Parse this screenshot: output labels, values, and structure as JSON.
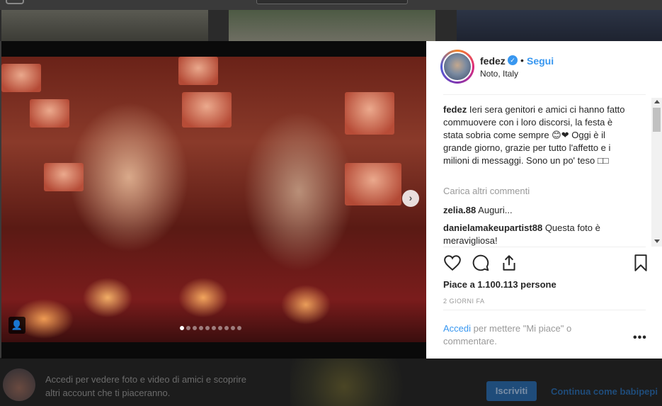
{
  "post": {
    "username": "fedez",
    "follow_label": "Segui",
    "separator": "•",
    "location": "Noto, Italy",
    "caption_user": "fedez",
    "caption_text": "Ieri sera genitori e amici ci hanno fatto commuovere con i loro discorsi, la festa è stata sobria come sempre 😊❤ Oggi è il grande giorno, grazie per tutto l'affetto e i milioni di messaggi. Sono un po' teso □□",
    "load_more": "Carica altri commenti",
    "comments": [
      {
        "user": "zelia.88",
        "text": "Auguri..."
      },
      {
        "user": "danielamakeupartist88",
        "text": "Questa foto è meravigliosa!"
      }
    ],
    "likes": "Piace a 1.100.113 persone",
    "timestamp": "2 GIORNI FA",
    "login_link": "Accedi",
    "login_rest": " per mettere \"Mi piace\" o commentare.",
    "more_options": "•••"
  },
  "carousel": {
    "dots_total": 10,
    "active_index": 0
  },
  "signup_bar": {
    "text": "Accedi per vedere foto e video di amici e scoprire altri account che ti piaceranno.",
    "register_label": "Iscriviti",
    "continue_label": "Continua come babipepi"
  },
  "colors": {
    "accent": "#3897f0",
    "text": "#262626",
    "muted": "#999999"
  },
  "icons": [
    "heart-icon",
    "comment-icon",
    "share-icon",
    "bookmark-icon",
    "verified-icon",
    "person-tag-icon",
    "next-arrow-icon"
  ]
}
